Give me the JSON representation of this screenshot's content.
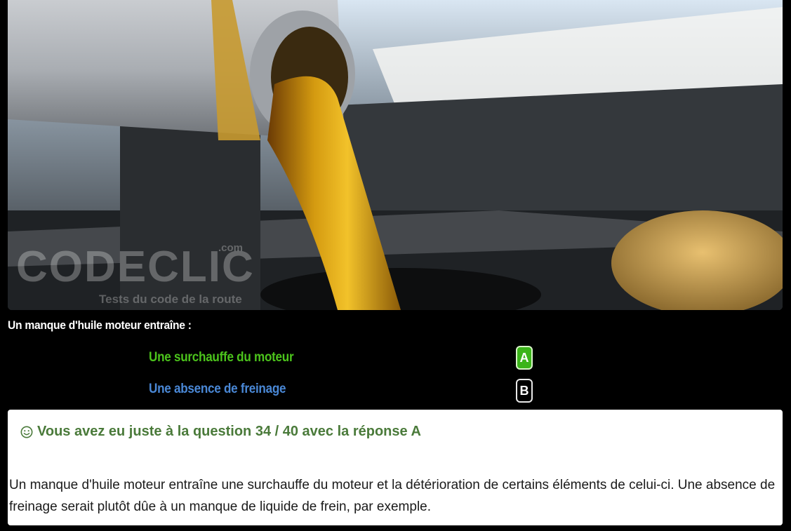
{
  "photo": {
    "alt": "Huile moteur versée dans le moteur",
    "watermark_brand": "CODECLIC",
    "watermark_domain": ".com",
    "watermark_tagline": "Tests du code de la route"
  },
  "question": {
    "text": "Un manque d'huile moteur entraîne :"
  },
  "answers": [
    {
      "text": "Une surchauffe du moteur",
      "letter": "A"
    },
    {
      "text": "Une absence de freinage",
      "letter": "B"
    }
  ],
  "feedback": {
    "title": "Vous avez eu juste à la question 34 / 40 avec la réponse A",
    "explanation": "Un manque d'huile moteur entraîne une surchauffe du moteur et la détérioration de certains éléments de celui-ci. Une absence de freinage serait plutôt dûe à un manque de liquide de frein, par exemple."
  },
  "colors": {
    "correct": "#4cc41c",
    "neutral": "#4a88d6",
    "feedback_title": "#4a7a3a"
  },
  "icons": {
    "feedback": "smile-icon"
  }
}
